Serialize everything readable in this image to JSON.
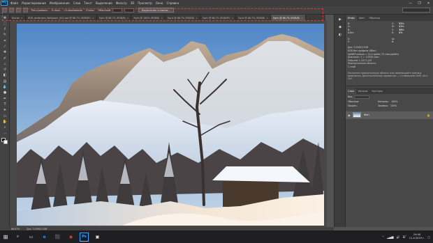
{
  "menu": [
    "Файл",
    "Редактирование",
    "Изображение",
    "Слои",
    "Текст",
    "Выделение",
    "Фильтр",
    "3D",
    "Просмотр",
    "Окно",
    "Справка"
  ],
  "window_controls": [
    "—",
    "❐",
    "✕"
  ],
  "options": {
    "label1": "Растушевка:",
    "value1": "0 пикс.",
    "label2": "Сглаживание",
    "label3": "Стиль:",
    "style_value": "Обычный",
    "button": "Выделение и маска..."
  },
  "tabs": [
    {
      "label": "Бытие",
      "close": "×"
    },
    {
      "label": "HDR_landscape_Wallpaper_002.psd @ 66,7% (RGB/8*)",
      "close": "×"
    },
    {
      "label": "Egris @ 66,7% (RGB/8)",
      "close": "×"
    },
    {
      "label": "Egris @ 100% (RGB/8)",
      "close": "×"
    },
    {
      "label": "Egris @ 66,7% (RGB/8)",
      "close": "×"
    },
    {
      "label": "Egris @ 66,7% (RGB/8*)",
      "close": "×"
    },
    {
      "label": "Egris @ 66,7% (RGB/8)",
      "close": "×"
    },
    {
      "label": "Egris @ 66,7% (RGB/8)",
      "close": "×"
    }
  ],
  "active_tab_index": 7,
  "panel_tabs_top": [
    "Инфо",
    "Цвет",
    "Образцы"
  ],
  "info": {
    "col_left": [
      [
        "R:",
        ""
      ],
      [
        "G:",
        ""
      ],
      [
        "B:",
        ""
      ],
      [
        "8-бит",
        ""
      ]
    ],
    "col_right": [
      [
        "C:",
        "52%"
      ],
      [
        "M:",
        "41%"
      ],
      [
        "Y:",
        "38%"
      ],
      [
        "K:",
        "4%"
      ]
    ],
    "xy": [
      [
        "X:",
        ""
      ],
      [
        "Y:",
        ""
      ]
    ],
    "wh": [
      [
        "Ш:",
        ""
      ],
      [
        "В:",
        ""
      ]
    ],
    "details": [
      "Док: 3,50M/3,50M",
      "RGB без профиля (8бит)",
      "ЦИФЕР режим = 24,0 дюйм (72 пикс/дюйм)",
      "Диапазон: 1 = 1,0000 пикс",
      "Рабочий: 1,22Г/1,22Г",
      "Прямоугольная область",
      "1 слой"
    ],
    "hint": "Растяните прямоугольную область или перемещайте границу выделения. Дополнительные параметры — с клавишами Shift, Alt и Ctrl."
  },
  "layers_tabs": [
    "Слои",
    "Каналы",
    "Контуры"
  ],
  "layers": {
    "kind_label": "Вид",
    "blend": "Обычные",
    "opacity_label": "Непрозр.:",
    "opacity": "100%",
    "lock_label": "Закреп.:",
    "fill_label": "Заливка:",
    "fill": "100%",
    "layer_name": "Фон"
  },
  "status": {
    "zoom": "66,67%",
    "doc": "Док: 3,50M/3,50M"
  },
  "taskbar": {
    "apps": [
      "⌕",
      "▭",
      "e",
      "⬛",
      "◉",
      "Ps",
      "▣"
    ],
    "time": "19:40",
    "date": "11.4.2019 г.",
    "lang": "БГ"
  },
  "colors": {
    "accent_blue": "#31a8ff",
    "highlight": "#e03a3a"
  }
}
